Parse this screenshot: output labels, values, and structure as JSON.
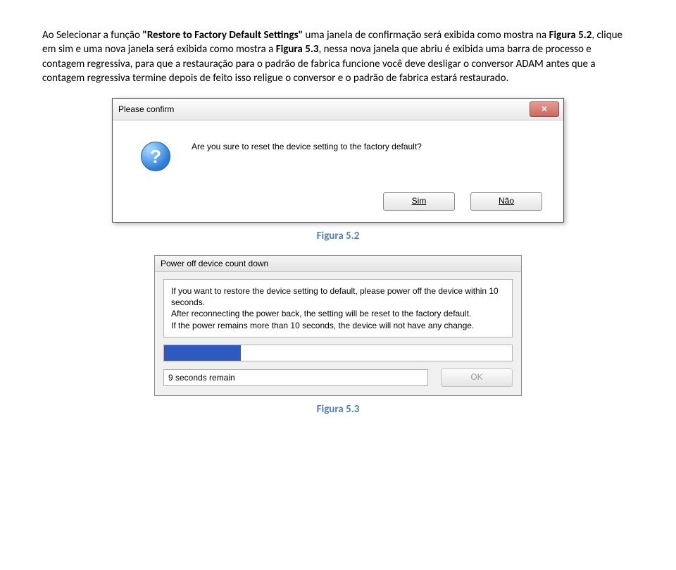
{
  "para": {
    "p1a": "Ao Selecionar a função ",
    "p1b": "\"Restore to Factory Default Settings\"",
    "p1c": " uma janela de confirmação será exibida como mostra na ",
    "p1d": "Figura 5.2",
    "p1e": ", clique em sim e uma nova janela será exibida como mostra a ",
    "p1f": "Figura 5.3",
    "p1g": ", nessa nova janela que abriu é exibida uma barra de processo e contagem regressiva, para que a restauração para o padrão de fabrica funcione você deve desligar o conversor ADAM antes que a contagem regressiva termine depois de feito isso religue o conversor e o padrão de fabrica estará restaurado."
  },
  "confirmDialog": {
    "title": "Please confirm",
    "close": "×",
    "icon": "?",
    "message": "Are you sure to reset the device setting to the factory default?",
    "btnYes": "Sim",
    "btnNo": "Não"
  },
  "caption1": "Figura 5.2",
  "countdownDialog": {
    "title": "Power off device count down",
    "msg1": "If you want to restore the device setting to default, please power off the device within 10 seconds.",
    "msg2": "After reconnecting the power back, the setting will be reset to the factory default.",
    "msg3": "If the power remains more than 10 seconds, the device will not have any change.",
    "remain": "9 seconds remain",
    "ok": "OK"
  },
  "caption2": "Figura 5.3"
}
